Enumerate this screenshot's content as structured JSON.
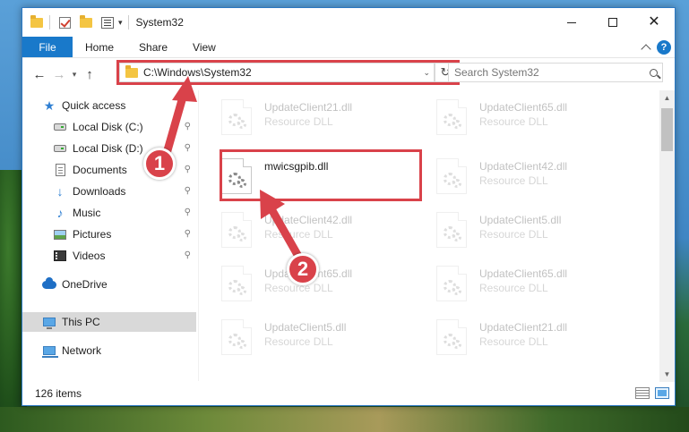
{
  "window": {
    "title": "System32",
    "controls": {
      "minimize": "—",
      "maximize": "☐",
      "close": "✕"
    }
  },
  "ribbon": {
    "file_tab": "File",
    "tabs": [
      "Home",
      "Share",
      "View"
    ],
    "help": "?"
  },
  "nav": {
    "back": "←",
    "forward": "→",
    "recent_dropdown": "▾",
    "up": "↑",
    "address": "C:\\Windows\\System32",
    "address_dropdown": "⌄",
    "refresh": "↻",
    "search_placeholder": "Search System32"
  },
  "sidebar": {
    "items": [
      {
        "label": "Quick access",
        "icon": "star-icon",
        "pinned": false
      },
      {
        "label": "Local Disk (C:)",
        "icon": "drive-icon",
        "pinned": true
      },
      {
        "label": "Local Disk (D:)",
        "icon": "drive-icon",
        "pinned": true
      },
      {
        "label": "Documents",
        "icon": "document-icon",
        "pinned": true
      },
      {
        "label": "Downloads",
        "icon": "download-icon",
        "pinned": true
      },
      {
        "label": "Music",
        "icon": "music-icon",
        "pinned": true
      },
      {
        "label": "Pictures",
        "icon": "pictures-icon",
        "pinned": true
      },
      {
        "label": "Videos",
        "icon": "videos-icon",
        "pinned": true
      },
      {
        "label": "OneDrive",
        "icon": "cloud-icon",
        "pinned": false
      },
      {
        "label": "This PC",
        "icon": "computer-icon",
        "pinned": false,
        "selected": true
      },
      {
        "label": "Network",
        "icon": "network-icon",
        "pinned": false
      }
    ],
    "pin_glyph": "📌"
  },
  "files": [
    {
      "name": "UpdateClient21.dll",
      "type": "Resource DLL",
      "faded": true
    },
    {
      "name": "UpdateClient65.dll",
      "type": "Resource DLL",
      "faded": true
    },
    {
      "name": "mwicsgpib.dll",
      "type": "",
      "faded": false,
      "highlighted": true
    },
    {
      "name": "UpdateClient42.dll",
      "type": "Resource DLL",
      "faded": true
    },
    {
      "name": "UpdateClient42.dll",
      "type": "Resource DLL",
      "faded": true
    },
    {
      "name": "UpdateClient5.dll",
      "type": "Resource DLL",
      "faded": true
    },
    {
      "name": "UpdateClient65.dll",
      "type": "Resource DLL",
      "faded": true
    },
    {
      "name": "UpdateClient65.dll",
      "type": "Resource DLL",
      "faded": true
    },
    {
      "name": "UpdateClient5.dll",
      "type": "Resource DLL",
      "faded": true
    },
    {
      "name": "UpdateClient21.dll",
      "type": "Resource DLL",
      "faded": true
    }
  ],
  "status": {
    "item_count": "126 items"
  },
  "annotations": {
    "step1": "1",
    "step2": "2",
    "color": "#d9424a"
  },
  "colors": {
    "accent": "#1979ca",
    "selection": "#cce8ff",
    "highlight": "#d9424a"
  }
}
